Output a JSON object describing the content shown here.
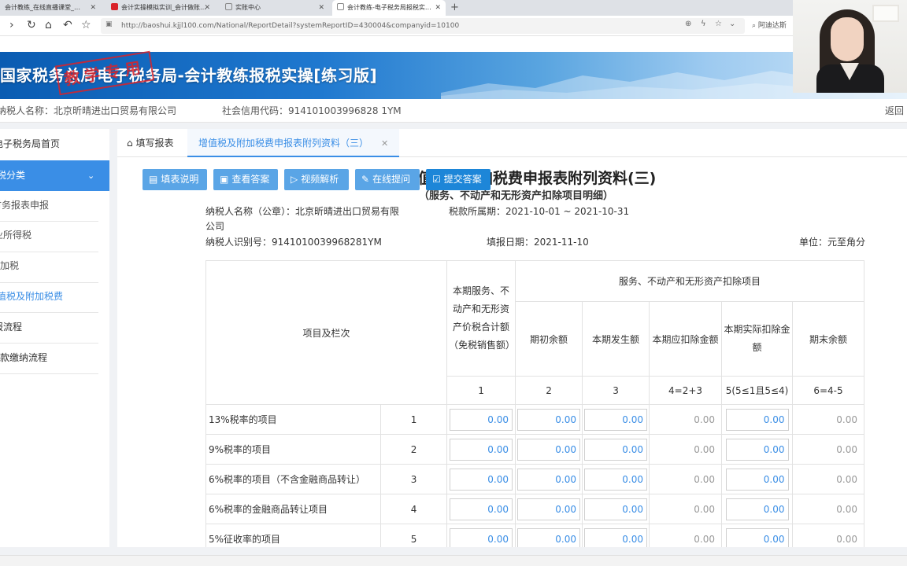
{
  "browser": {
    "tabs": [
      {
        "label": "会计教练_在线直播课堂_…"
      },
      {
        "label": "会计实操模拟实训_会计做账…"
      },
      {
        "label": "实账中心"
      },
      {
        "label": "会计教练-电子税务局报税实…"
      }
    ],
    "new_tab": "+",
    "url": "http://baoshui.kjjl100.com/National/ReportDetail?systemReportID=430004&companyid=10100",
    "search_label": "阿迪达斯"
  },
  "banner": {
    "title": "国家税务总局电子税务局-会计教练报税实操[练习版]",
    "stamp": "教学专用"
  },
  "infobar": {
    "taxpayer": "纳税人名称：北京昕晴进出口贸易有限公司",
    "credit_code": "社会信用代码：914101003996828 1YM",
    "return": "返回"
  },
  "sidebar": {
    "home": "电子税务局首页",
    "category": "报税分类",
    "items": [
      "财务报表申报",
      "企业所得税",
      "附加税",
      "增值税及附加税费",
      "申报流程",
      "税款缴纳流程"
    ]
  },
  "tabs": {
    "fill": "填写报表",
    "current": "增值税及附加税费申报表附列资料（三）"
  },
  "toolbar": {
    "explain": "填表说明",
    "answer": "查看答案",
    "video": "视频解析",
    "ask": "在线提问",
    "submit": "提交答案"
  },
  "form": {
    "title": "增值税及附加税费申报表附列资料(三)",
    "subtitle": "（服务、不动产和无形资产扣除项目明细）",
    "taxpayer_name_label": "纳税人名称（公章）：北京昕晴进出口贸易有限",
    "taxpayer_name_cont": "公司",
    "period": "税款所属期：2021-10-01 ~ 2021-10-31",
    "taxpayer_id": "纳税人识别号：9141010039968281YM",
    "fill_date": "填报日期：2021-11-10",
    "unit": "单位：元至角分"
  },
  "table": {
    "item_header": "项目及栏次",
    "col1_header": "本期服务、不动产和无形资产价税合计额（免税销售额）",
    "group_header": "服务、不动产和无形资产扣除项目",
    "sub_headers": [
      "期初余额",
      "本期发生额",
      "本期应扣除金额",
      "本期实际扣除金额",
      "期末余额"
    ],
    "col_numbers": [
      "1",
      "2",
      "3",
      "4=2+3",
      "5(5≤1且5≤4)",
      "6=4-5"
    ],
    "rows": [
      {
        "label": "13%税率的项目",
        "no": "1",
        "v": [
          "0.00",
          "0.00",
          "0.00",
          "0.00",
          "0.00",
          "0.00"
        ]
      },
      {
        "label": "9%税率的项目",
        "no": "2",
        "v": [
          "0.00",
          "0.00",
          "0.00",
          "0.00",
          "0.00",
          "0.00"
        ]
      },
      {
        "label": "6%税率的项目（不含金融商品转让）",
        "no": "3",
        "v": [
          "0.00",
          "0.00",
          "0.00",
          "0.00",
          "0.00",
          "0.00"
        ]
      },
      {
        "label": "6%税率的金融商品转让项目",
        "no": "4",
        "v": [
          "0.00",
          "0.00",
          "0.00",
          "0.00",
          "0.00",
          "0.00"
        ]
      },
      {
        "label": "5%征收率的项目",
        "no": "5",
        "v": [
          "0.00",
          "0.00",
          "0.00",
          "0.00",
          "0.00",
          "0.00"
        ]
      }
    ]
  },
  "colors": {
    "accent": "#3a8ee6",
    "button": "#5aa5e6",
    "banner": "#0a5cb2",
    "stamp": "#d9232a"
  }
}
